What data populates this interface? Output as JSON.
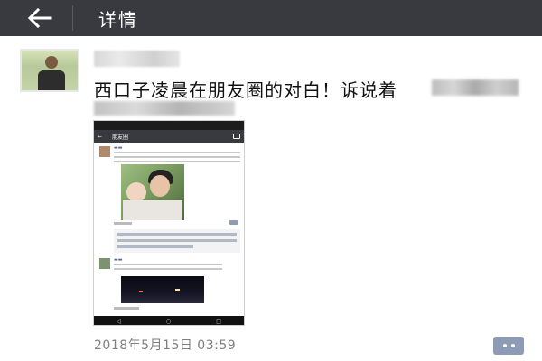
{
  "header": {
    "title": "详情",
    "back_icon": "arrow-left-icon"
  },
  "post": {
    "text": "西口子凌晨在朋友圈的对白！诉说着",
    "timestamp": "2018年5月15日 03:59",
    "comment_icon": "comment-dots-icon"
  },
  "phone_screenshot": {
    "title": "朋友圈",
    "nav_back": "◁",
    "nav_home": "○",
    "nav_recent": "□"
  },
  "colors": {
    "header_bg": "#393a3f",
    "comment_button": "#8e9bb4",
    "timestamp": "#7f7f7f"
  }
}
